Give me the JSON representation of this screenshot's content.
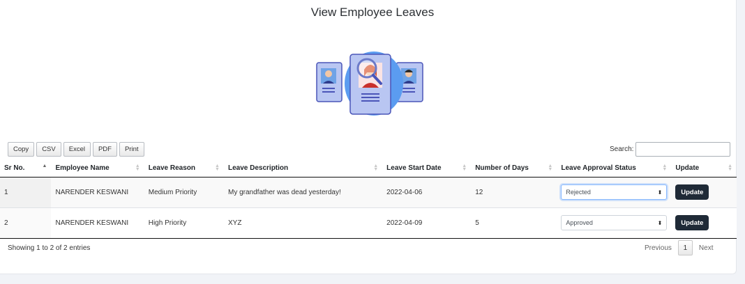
{
  "page": {
    "title": "View Employee Leaves"
  },
  "toolbar": {
    "buttons": [
      "Copy",
      "CSV",
      "Excel",
      "PDF",
      "Print"
    ],
    "search_label": "Search:",
    "search_value": ""
  },
  "table": {
    "columns": [
      "Sr No.",
      "Employee Name",
      "Leave Reason",
      "Leave Description",
      "Leave Start Date",
      "Number of Days",
      "Leave Approval Status",
      "Update"
    ],
    "rows": [
      {
        "sr": "1",
        "name": "NARENDER KESWANI",
        "reason": "Medium Priority",
        "description": "My grandfather was dead yesterday!",
        "start_date": "2022-04-06",
        "days": "12",
        "status": "Rejected",
        "update_label": "Update"
      },
      {
        "sr": "2",
        "name": "NARENDER KESWANI",
        "reason": "High Priority",
        "description": "XYZ",
        "start_date": "2022-04-09",
        "days": "5",
        "status": "Approved",
        "update_label": "Update"
      }
    ]
  },
  "footer": {
    "info": "Showing 1 to 2 of 2 entries",
    "previous": "Previous",
    "current_page": "1",
    "next": "Next"
  },
  "colors": {
    "update_button": "#1f2a37",
    "illustration_accent": "#5b9cf0"
  },
  "icons": [
    "employee-search-illustration",
    "sort-icon",
    "select-caret-icon"
  ]
}
